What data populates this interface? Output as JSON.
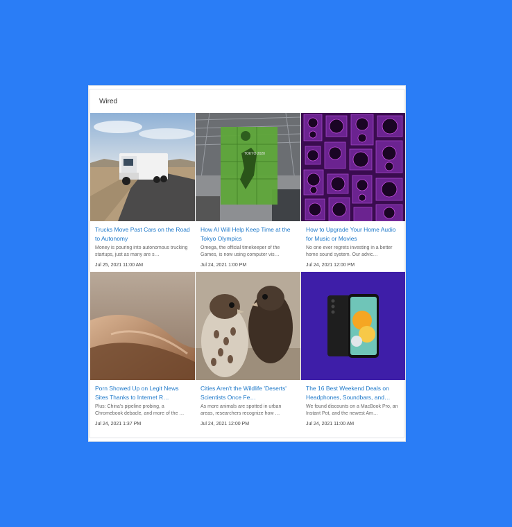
{
  "feed": {
    "title": "Wired"
  },
  "articles": [
    {
      "title": "Trucks Move Past Cars on the Road to Autonomy",
      "description": "Money is pouring into autonomous trucking startups, just as many are s…",
      "date": "Jul 25, 2021 11:00 AM",
      "image": "semi-truck-on-desert-highway"
    },
    {
      "title": "How AI Will Help Keep Time at the Tokyo Olympics",
      "description": "Omega, the official timekeeper of the Games, is now using computer vis…",
      "date": "Jul 24, 2021 1:00 PM",
      "image": "volleyball-player-tokyo-2020",
      "image_text": "TOKYO 2020"
    },
    {
      "title": "How to Upgrade Your Home Audio for Music or Movies",
      "description": "No one ever regrets investing in a better home sound system. Our advic…",
      "date": "Jul 24, 2021 12:00 PM",
      "image": "wall-of-purple-speakers"
    },
    {
      "title": "Porn Showed Up on Legit News Sites Thanks to Internet R…",
      "description": "Plus: China's pipeline probing, a Chromebook debacle, and more of the …",
      "date": "Jul 24, 2021 1:37 PM",
      "image": "abstract-skin-curves"
    },
    {
      "title": "Cities Aren't the Wildlife 'Deserts' Scientists Once Fe…",
      "description": "As more animals are spotted in urban areas, researchers recognize how …",
      "date": "Jul 24, 2021 12:00 PM",
      "image": "falcon-chicks"
    },
    {
      "title": "The 16 Best Weekend Deals on Headphones, Soundbars, and…",
      "description": "We found discounts on a MacBook Pro, an Instant Pot, and the newest Am…",
      "date": "Jul 24, 2021 11:00 AM",
      "image": "smartphone-on-purple"
    }
  ],
  "colors": {
    "page_background": "#2a7df6",
    "link": "#1d78c9"
  }
}
